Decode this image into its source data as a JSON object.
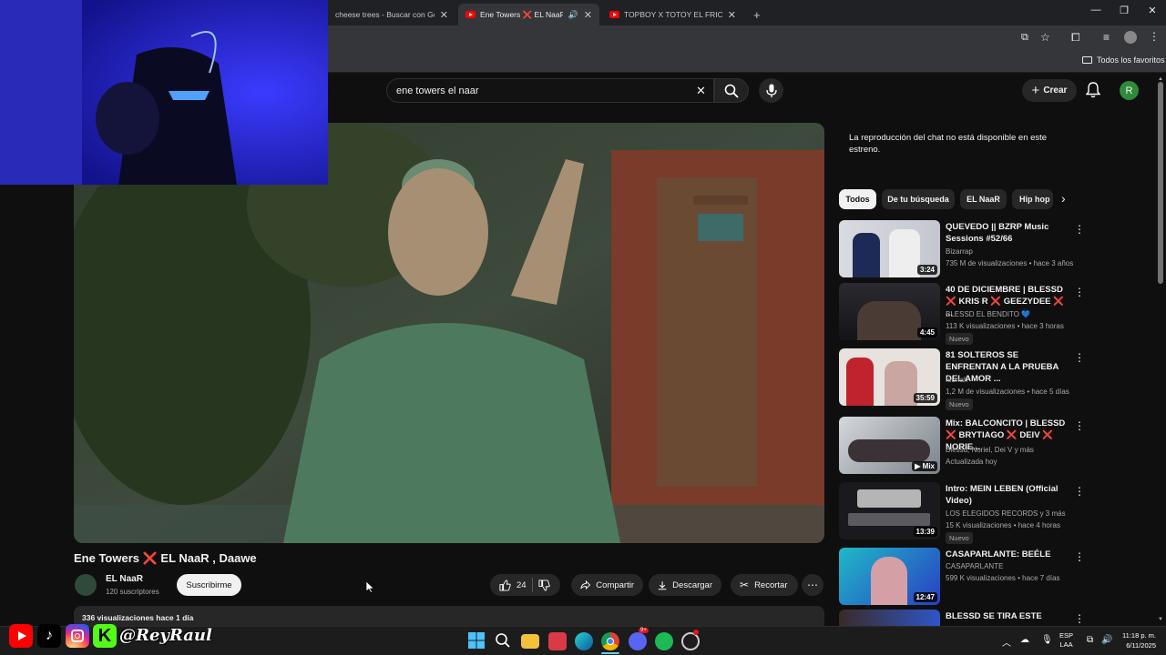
{
  "browser": {
    "tabs": [
      {
        "label": "cheese trees - Buscar con Goog"
      },
      {
        "label": "Ene Towers ❌ EL NaaR , D",
        "active": true
      },
      {
        "label": "TOPBOY X TOTOY EL FRIO - CH"
      }
    ],
    "new_tab": "+",
    "bookmarks_label": "Todos los favoritos"
  },
  "youtube": {
    "search_value": "ene towers el naar",
    "create_label": "Crear",
    "avatar_letter": "R",
    "video": {
      "title": "Ene Towers ❌ EL NaaR , Daawe",
      "channel": "EL NaaR",
      "subscribers": "120 suscriptores",
      "subscribe_label": "Suscribirme",
      "likes": "24",
      "share_label": "Compartir",
      "download_label": "Descargar",
      "clip_label": "Recortar",
      "views_date": "336 visualizaciones  hace 1 día"
    },
    "chat_message": "La reproducción del chat no está disponible en este estreno.",
    "chips": [
      "Todos",
      "De tu búsqueda",
      "EL NaaR",
      "Hip hop"
    ],
    "recommendations": [
      {
        "title": "QUEVEDO || BZRP Music Sessions #52/66",
        "channel": "Bizarrap",
        "meta": "735 M de visualizaciones • hace 3 años",
        "duration": "3:24",
        "badge": ""
      },
      {
        "title": "40 DE DICIEMBRE | BLESSD ❌ KRIS R ❌ GEEZYDEE ❌ ...",
        "channel": "BLESSD EL BENDITO 💙",
        "meta": "113 K visualizaciones • hace 3 horas",
        "duration": "4:45",
        "badge": "Nuevo"
      },
      {
        "title": "81 SOLTEROS SE ENFRENTAN A LA PRUEBA DEL AMOR ...",
        "channel": "Iebriah",
        "meta": "1,2 M de visualizaciones • hace 5 días",
        "duration": "35:59",
        "badge": "Nuevo"
      },
      {
        "title": "Mix: BALCONCITO |  BLESSD ❌ BRYTIAGO ❌ DEIV ❌ NORIE...",
        "channel": "Blessd, Noriel, Dei V y más",
        "meta": "Actualizada hoy",
        "duration": "Mix",
        "badge": ""
      },
      {
        "title": "Intro: MEIN LEBEN (Official Video)",
        "channel": "LOS ELEGIDOS RECORDS y 3 más",
        "meta": "15 K visualizaciones • hace 4 horas",
        "duration": "13:39",
        "badge": "Nuevo"
      },
      {
        "title": "CASAPARLANTE: BEÉLE",
        "channel": "CASAPARLANTE",
        "meta": "599 K visualizaciones • hace 7 días",
        "duration": "12:47",
        "badge": ""
      },
      {
        "title": "BLESSD SE TIRA ESTE",
        "channel": "",
        "meta": "",
        "duration": "",
        "badge": ""
      }
    ]
  },
  "overlay": {
    "handle": "@ReyRaul",
    "socials": [
      "youtube-icon",
      "tiktok-icon",
      "instagram-icon",
      "kick-icon"
    ],
    "kick_letter": "K"
  },
  "taskbar": {
    "lang": "ESP",
    "region": "LAA",
    "time": "11:18 p. m.",
    "date": "6/11/2025",
    "discord_badge": "9+"
  },
  "colors": {
    "yt_bg": "#0f0f0f",
    "chip_bg": "#272727",
    "yt_red": "#ff0000",
    "avatar_green": "#2e8b3b",
    "kick_green": "#53fc18"
  }
}
